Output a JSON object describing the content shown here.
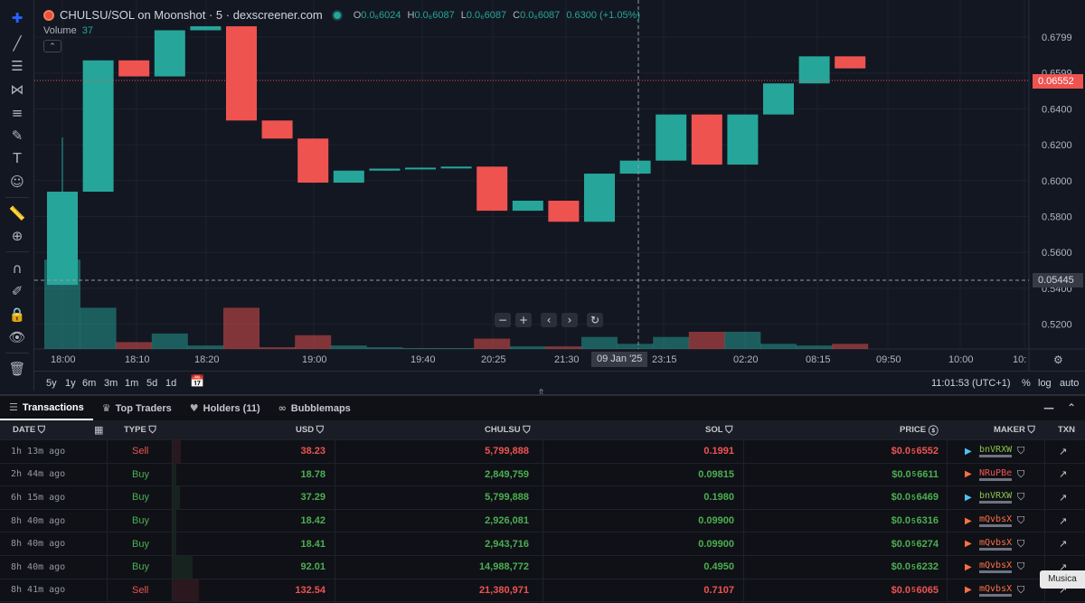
{
  "header": {
    "title": "CHULSU/SOL on Moonshot · 5 · dexscreener.com",
    "ohlc": [
      {
        "k": "O",
        "v": "0.0₆6024"
      },
      {
        "k": "H",
        "v": "0.0₆6087"
      },
      {
        "k": "L",
        "v": "0.0₆6087"
      },
      {
        "k": "C",
        "v": "0.0₆6087"
      }
    ],
    "change": "0.6300 (+1.05%)",
    "volume_label": "Volume",
    "volume_value": "37"
  },
  "price_axis": {
    "ticks": [
      "0.6799",
      "0.6599",
      "0.6400",
      "0.6200",
      "0.6000",
      "0.5800",
      "0.5600",
      "0.5400",
      "0.5200"
    ],
    "current_price_label": "0.06552",
    "crosshair_price_label": "0.05445"
  },
  "time_axis": {
    "ticks": [
      "18:00",
      "18:10",
      "18:20",
      "19:00",
      "19:40",
      "20:25",
      "21:30",
      "23:15",
      "02:20",
      "08:15",
      "09:50",
      "10:00",
      "10:"
    ],
    "crosshair_label": "09 Jan '25"
  },
  "chart_data": {
    "type": "candlestick",
    "title": "CHULSU/SOL on Moonshot · 5 · dexscreener.com",
    "ylim": [
      0.515,
      0.685
    ],
    "candles": [
      {
        "o": 0.5465,
        "h": 0.62,
        "l": 0.5465,
        "c": 0.593,
        "vol": 0.52
      },
      {
        "o": 0.593,
        "h": 0.6585,
        "l": 0.593,
        "c": 0.6585,
        "vol": 0.24
      },
      {
        "o": 0.6585,
        "h": 0.6585,
        "l": 0.6505,
        "c": 0.6505,
        "vol": 0.04
      },
      {
        "o": 0.6505,
        "h": 0.6735,
        "l": 0.6505,
        "c": 0.6735,
        "vol": 0.09
      },
      {
        "o": 0.6735,
        "h": 0.6755,
        "l": 0.6735,
        "c": 0.6755,
        "vol": 0.02
      },
      {
        "o": 0.6755,
        "h": 0.6755,
        "l": 0.6285,
        "c": 0.6285,
        "vol": 0.24
      },
      {
        "o": 0.6285,
        "h": 0.6285,
        "l": 0.6195,
        "c": 0.6195,
        "vol": 0.01
      },
      {
        "o": 0.6195,
        "h": 0.6195,
        "l": 0.5975,
        "c": 0.5975,
        "vol": 0.08
      },
      {
        "o": 0.5975,
        "h": 0.6035,
        "l": 0.5975,
        "c": 0.6035,
        "vol": 0.02
      },
      {
        "o": 0.6035,
        "h": 0.6045,
        "l": 0.6035,
        "c": 0.6045,
        "vol": 0.01
      },
      {
        "o": 0.6045,
        "h": 0.605,
        "l": 0.6045,
        "c": 0.605,
        "vol": 0.005
      },
      {
        "o": 0.605,
        "h": 0.6055,
        "l": 0.605,
        "c": 0.6055,
        "vol": 0.005
      },
      {
        "o": 0.6055,
        "h": 0.6055,
        "l": 0.5835,
        "c": 0.5835,
        "vol": 0.06
      },
      {
        "o": 0.5835,
        "h": 0.5885,
        "l": 0.5835,
        "c": 0.5885,
        "vol": 0.015
      },
      {
        "o": 0.5885,
        "h": 0.5885,
        "l": 0.578,
        "c": 0.578,
        "vol": 0.015
      },
      {
        "o": 0.578,
        "h": 0.602,
        "l": 0.578,
        "c": 0.602,
        "vol": 0.07
      },
      {
        "o": 0.602,
        "h": 0.6085,
        "l": 0.602,
        "c": 0.6085,
        "vol": 0.03
      },
      {
        "o": 0.6085,
        "h": 0.6315,
        "l": 0.6085,
        "c": 0.6315,
        "vol": 0.07
      },
      {
        "o": 0.6315,
        "h": 0.6315,
        "l": 0.6065,
        "c": 0.6065,
        "vol": 0.1
      },
      {
        "o": 0.6065,
        "h": 0.6315,
        "l": 0.6065,
        "c": 0.6315,
        "vol": 0.1
      },
      {
        "o": 0.6315,
        "h": 0.647,
        "l": 0.6315,
        "c": 0.647,
        "vol": 0.03
      },
      {
        "o": 0.647,
        "h": 0.6605,
        "l": 0.647,
        "c": 0.6605,
        "vol": 0.02
      },
      {
        "o": 0.6605,
        "h": 0.6605,
        "l": 0.6545,
        "c": 0.6545,
        "vol": 0.03
      }
    ]
  },
  "range_bar": {
    "ranges": [
      "5y",
      "1y",
      "6m",
      "3m",
      "1m",
      "5d",
      "1d"
    ],
    "clock": "11:01:53 (UTC+1)",
    "percent": "%",
    "log": "log",
    "auto": "auto"
  },
  "tabs": [
    {
      "label": "Transactions"
    },
    {
      "label": "Top Traders"
    },
    {
      "label": "Holders (11)"
    },
    {
      "label": "Bubblemaps"
    }
  ],
  "table": {
    "headers": {
      "date": "DATE",
      "type": "TYPE",
      "usd": "USD",
      "token": "CHULSU",
      "sol": "SOL",
      "price": "PRICE",
      "maker": "MAKER",
      "txn": "TXN"
    },
    "rows": [
      {
        "date": "1h 13m ago",
        "type": "Sell",
        "usd": "38.23",
        "token": "5,799,888",
        "sol": "0.1991",
        "price_pre": "$0.0",
        "price_sub": "5",
        "price_post": "6552",
        "maker": "bnVRXW",
        "maker_color": "#8bc34a",
        "maker_icon": "#4fc3f7"
      },
      {
        "date": "2h 44m ago",
        "type": "Buy",
        "usd": "18.78",
        "token": "2,849,759",
        "sol": "0.09815",
        "price_pre": "$0.0",
        "price_sub": "5",
        "price_post": "6611",
        "maker": "NRuPBe",
        "maker_color": "#ef5350",
        "maker_icon": "#ff7043"
      },
      {
        "date": "6h 15m ago",
        "type": "Buy",
        "usd": "37.29",
        "token": "5,799,888",
        "sol": "0.1980",
        "price_pre": "$0.0",
        "price_sub": "5",
        "price_post": "6469",
        "maker": "bnVRXW",
        "maker_color": "#8bc34a",
        "maker_icon": "#4fc3f7"
      },
      {
        "date": "8h 40m ago",
        "type": "Buy",
        "usd": "18.42",
        "token": "2,926,081",
        "sol": "0.09900",
        "price_pre": "$0.0",
        "price_sub": "5",
        "price_post": "6316",
        "maker": "mQvbsX",
        "maker_color": "#ff7043",
        "maker_icon": "#ff7043"
      },
      {
        "date": "8h 40m ago",
        "type": "Buy",
        "usd": "18.41",
        "token": "2,943,716",
        "sol": "0.09900",
        "price_pre": "$0.0",
        "price_sub": "5",
        "price_post": "6274",
        "maker": "mQvbsX",
        "maker_color": "#ff7043",
        "maker_icon": "#ff7043"
      },
      {
        "date": "8h 40m ago",
        "type": "Buy",
        "usd": "92.01",
        "token": "14,988,772",
        "sol": "0.4950",
        "price_pre": "$0.0",
        "price_sub": "5",
        "price_post": "6232",
        "maker": "mQvbsX",
        "maker_color": "#ff7043",
        "maker_icon": "#ff7043"
      },
      {
        "date": "8h 41m ago",
        "type": "Sell",
        "usd": "132.54",
        "token": "21,380,971",
        "sol": "0.7107",
        "price_pre": "$0.0",
        "price_sub": "5",
        "price_post": "6065",
        "maker": "mQvbsX",
        "maker_color": "#ff7043",
        "maker_icon": "#ff7043"
      }
    ]
  },
  "overlay": {
    "label": "Musica"
  },
  "colors": {
    "up": "#26a69a",
    "down": "#ef5350",
    "background": "#131722"
  }
}
